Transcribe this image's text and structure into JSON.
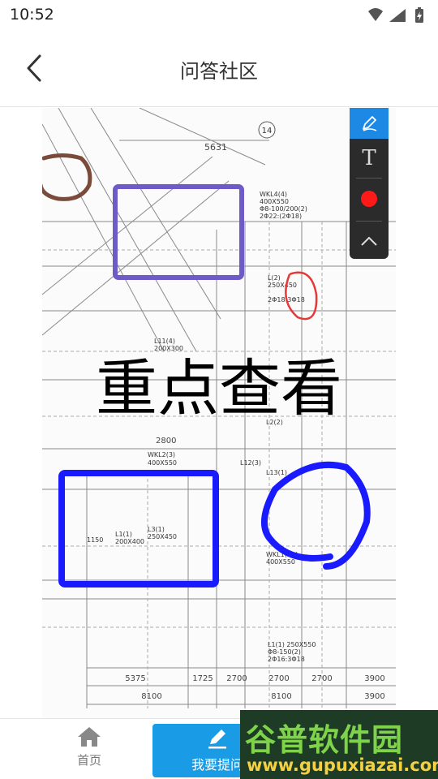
{
  "status_bar": {
    "time": "10:52",
    "icons": [
      "wifi-icon",
      "signal-icon",
      "battery-charging-icon"
    ]
  },
  "nav": {
    "title": "问答社区",
    "back_icon": "chevron-left-icon"
  },
  "drawing": {
    "dimensions_row1": [
      "5375",
      "1725",
      "2700",
      "2700",
      "2700",
      "3900"
    ],
    "dimensions_row2": [
      "8100",
      "8100",
      "3900"
    ],
    "dim_top": "5631",
    "dim_mid": "2800",
    "axis_label": "14",
    "beam_labels": [
      "WKL4(4)",
      "400X550",
      "Φ8-100/200(2)",
      "2Φ22:(2Φ18)",
      "L(2)",
      "250X450",
      "2Φ18:3Φ18",
      "L11(4)",
      "200X300",
      "WKL2(3)",
      "400X550",
      "L1(1)",
      "200X400",
      "L3(1)",
      "250X450",
      "WKL1(2A)",
      "400X550",
      "L1(1) 250X550",
      "Φ8-150(2)",
      "2Φ16:3Φ18",
      "L12(3)",
      "L13(1)",
      "L2(2)",
      "1150"
    ],
    "annotation_text": "重点查看",
    "annotation_color": "#000000",
    "circle_colors": [
      "#7a4a3a",
      "#e53935",
      "#1a1aff"
    ],
    "rect_colors": [
      "#6f5bc7",
      "#1a1aff"
    ]
  },
  "toolbar": {
    "pen_icon": "pen-icon",
    "text_tool_label": "T",
    "color_selected": "#ff1a1a",
    "collapse_icon": "chevron-up-icon",
    "active_color": "#1e88e5"
  },
  "bottom": {
    "home_label": "首页",
    "home_icon": "home-icon",
    "ask_label": "我要提问",
    "ask_icon": "edit-icon",
    "accent": "#1a9be6"
  },
  "watermark": {
    "title": "谷普软件园",
    "url": "www.gupuxiazai.com"
  }
}
